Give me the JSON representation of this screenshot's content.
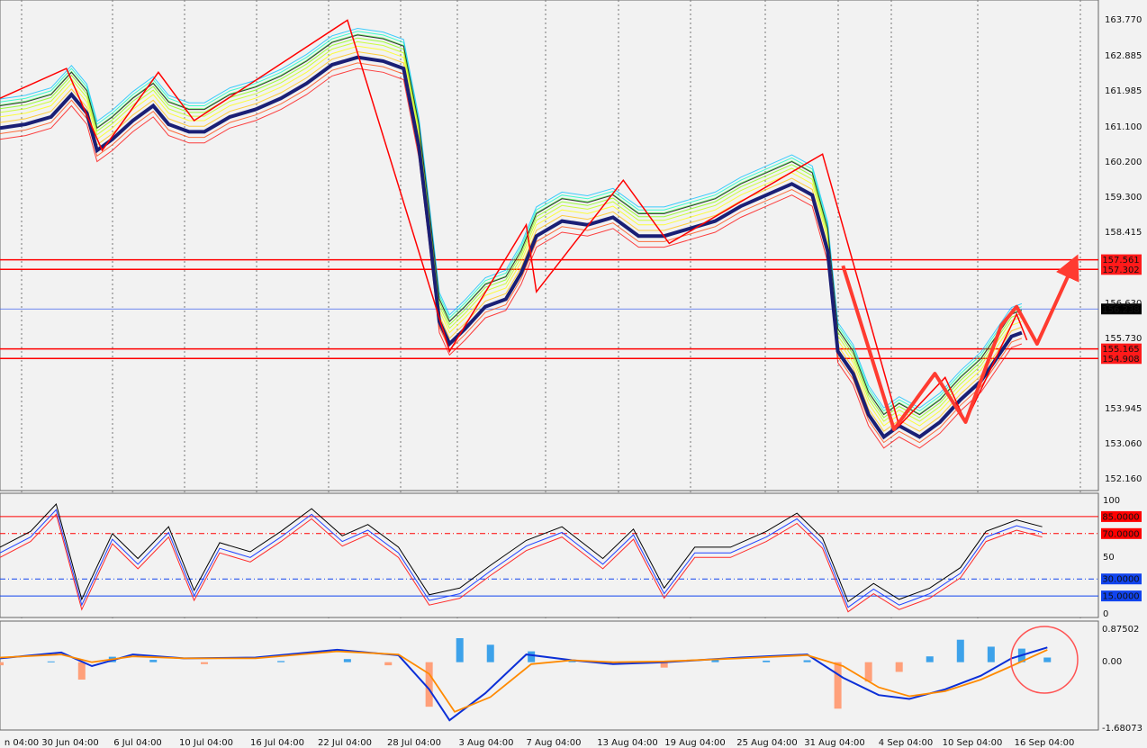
{
  "chart_data": [
    {
      "type": "candlestick",
      "panel": "main",
      "price_axis": {
        "ticks": [
          "163.770",
          "162.885",
          "161.985",
          "161.100",
          "160.200",
          "159.300",
          "158.415",
          "156.630",
          "155.730",
          "153.945",
          "153.060",
          "152.160"
        ],
        "ylim": [
          151.6,
          164.3
        ]
      },
      "level_lines": [
        {
          "label": "157.561",
          "value": 157.561,
          "color": "#ff0000"
        },
        {
          "label": "157.302",
          "value": 157.302,
          "color": "#ff0000"
        },
        {
          "label": "156.238",
          "value": 156.238,
          "color": "#4466ee"
        },
        {
          "label": "155.165",
          "value": 155.165,
          "color": "#ff0000"
        },
        {
          "label": "154.908",
          "value": 154.908,
          "color": "#ff0000"
        }
      ],
      "current_price_label": "156.238",
      "date_labels": [
        "n 04:00",
        "30 Jun 04:00",
        "6 Jul 04:00",
        "10 Jul 04:00",
        "16 Jul 04:00",
        "22 Jul 04:00",
        "28 Jul 04:00",
        "3 Aug 04:00",
        "7 Aug 04:00",
        "13 Aug 04:00",
        "19 Aug 04:00",
        "25 Aug 04:00",
        "31 Aug 04:00",
        "4 Sep 04:00",
        "10 Sep 04:00",
        "16 Sep 04:00"
      ],
      "close_path": [
        {
          "x": 0,
          "y": 161.7
        },
        {
          "x": 5,
          "y": 161.8
        },
        {
          "x": 10,
          "y": 162.0
        },
        {
          "x": 14,
          "y": 162.6
        },
        {
          "x": 17,
          "y": 162.1
        },
        {
          "x": 19,
          "y": 161.1
        },
        {
          "x": 22,
          "y": 161.4
        },
        {
          "x": 26,
          "y": 161.9
        },
        {
          "x": 30,
          "y": 162.3
        },
        {
          "x": 33,
          "y": 161.8
        },
        {
          "x": 37,
          "y": 161.6
        },
        {
          "x": 40,
          "y": 161.6
        },
        {
          "x": 45,
          "y": 162.0
        },
        {
          "x": 50,
          "y": 162.2
        },
        {
          "x": 55,
          "y": 162.5
        },
        {
          "x": 60,
          "y": 162.9
        },
        {
          "x": 65,
          "y": 163.4
        },
        {
          "x": 70,
          "y": 163.6
        },
        {
          "x": 75,
          "y": 163.5
        },
        {
          "x": 79,
          "y": 163.3
        },
        {
          "x": 82,
          "y": 161.2
        },
        {
          "x": 84,
          "y": 158.9
        },
        {
          "x": 86,
          "y": 156.5
        },
        {
          "x": 88,
          "y": 155.9
        },
        {
          "x": 91,
          "y": 156.3
        },
        {
          "x": 95,
          "y": 156.9
        },
        {
          "x": 99,
          "y": 157.1
        },
        {
          "x": 102,
          "y": 157.8
        },
        {
          "x": 105,
          "y": 158.8
        },
        {
          "x": 110,
          "y": 159.2
        },
        {
          "x": 115,
          "y": 159.1
        },
        {
          "x": 120,
          "y": 159.3
        },
        {
          "x": 125,
          "y": 158.8
        },
        {
          "x": 130,
          "y": 158.8
        },
        {
          "x": 135,
          "y": 159.0
        },
        {
          "x": 140,
          "y": 159.2
        },
        {
          "x": 145,
          "y": 159.6
        },
        {
          "x": 150,
          "y": 159.9
        },
        {
          "x": 155,
          "y": 160.2
        },
        {
          "x": 159,
          "y": 159.9
        },
        {
          "x": 162,
          "y": 158.4
        },
        {
          "x": 164,
          "y": 155.7
        },
        {
          "x": 167,
          "y": 155.1
        },
        {
          "x": 170,
          "y": 154.0
        },
        {
          "x": 173,
          "y": 153.4
        },
        {
          "x": 176,
          "y": 153.7
        },
        {
          "x": 180,
          "y": 153.4
        },
        {
          "x": 184,
          "y": 153.8
        },
        {
          "x": 188,
          "y": 154.4
        },
        {
          "x": 192,
          "y": 154.9
        },
        {
          "x": 195,
          "y": 155.5
        },
        {
          "x": 198,
          "y": 156.1
        },
        {
          "x": 200,
          "y": 156.2
        }
      ],
      "zigzag_points": [
        {
          "x": 0,
          "y": 161.9
        },
        {
          "x": 13,
          "y": 162.7
        },
        {
          "x": 20,
          "y": 160.5
        },
        {
          "x": 31,
          "y": 162.6
        },
        {
          "x": 38,
          "y": 161.3
        },
        {
          "x": 68,
          "y": 164.0
        },
        {
          "x": 88,
          "y": 155.1
        },
        {
          "x": 103,
          "y": 158.5
        },
        {
          "x": 105,
          "y": 156.7
        },
        {
          "x": 122,
          "y": 159.7
        },
        {
          "x": 131,
          "y": 158.0
        },
        {
          "x": 161,
          "y": 160.4
        },
        {
          "x": 176,
          "y": 153.1
        },
        {
          "x": 185,
          "y": 154.4
        },
        {
          "x": 189,
          "y": 153.2
        },
        {
          "x": 199,
          "y": 156.1
        },
        {
          "x": 201,
          "y": 155.4
        }
      ],
      "arrow_points": [
        {
          "x": 165,
          "y": 157.4
        },
        {
          "x": 175,
          "y": 153.0
        },
        {
          "x": 183,
          "y": 154.5
        },
        {
          "x": 189,
          "y": 153.2
        },
        {
          "x": 196,
          "y": 155.8
        },
        {
          "x": 199,
          "y": 156.3
        },
        {
          "x": 203,
          "y": 155.3
        },
        {
          "x": 210,
          "y": 157.4
        }
      ]
    },
    {
      "type": "line",
      "panel": "oscillator",
      "ylim": [
        0,
        100
      ],
      "levels": [
        {
          "label": "85.0000",
          "value": 85,
          "color": "#ff0000"
        },
        {
          "label": "70.0000",
          "value": 70,
          "color": "#ff0000"
        },
        {
          "label": "30.0000",
          "value": 30,
          "color": "#1144ee"
        },
        {
          "label": "15.0000",
          "value": 15,
          "color": "#1144ee"
        }
      ],
      "ticks": [
        "100",
        "50",
        "0"
      ],
      "series_values": [
        {
          "x": 0,
          "y": 58
        },
        {
          "x": 6,
          "y": 72
        },
        {
          "x": 11,
          "y": 96
        },
        {
          "x": 16,
          "y": 12
        },
        {
          "x": 22,
          "y": 70
        },
        {
          "x": 27,
          "y": 48
        },
        {
          "x": 33,
          "y": 76
        },
        {
          "x": 38,
          "y": 20
        },
        {
          "x": 43,
          "y": 62
        },
        {
          "x": 49,
          "y": 54
        },
        {
          "x": 55,
          "y": 72
        },
        {
          "x": 61,
          "y": 92
        },
        {
          "x": 67,
          "y": 68
        },
        {
          "x": 72,
          "y": 78
        },
        {
          "x": 78,
          "y": 58
        },
        {
          "x": 84,
          "y": 16
        },
        {
          "x": 90,
          "y": 22
        },
        {
          "x": 96,
          "y": 42
        },
        {
          "x": 103,
          "y": 64
        },
        {
          "x": 110,
          "y": 76
        },
        {
          "x": 118,
          "y": 48
        },
        {
          "x": 124,
          "y": 74
        },
        {
          "x": 130,
          "y": 22
        },
        {
          "x": 136,
          "y": 58
        },
        {
          "x": 143,
          "y": 58
        },
        {
          "x": 150,
          "y": 72
        },
        {
          "x": 156,
          "y": 88
        },
        {
          "x": 161,
          "y": 66
        },
        {
          "x": 166,
          "y": 10
        },
        {
          "x": 171,
          "y": 26
        },
        {
          "x": 176,
          "y": 12
        },
        {
          "x": 182,
          "y": 22
        },
        {
          "x": 188,
          "y": 40
        },
        {
          "x": 193,
          "y": 72
        },
        {
          "x": 199,
          "y": 82
        },
        {
          "x": 204,
          "y": 76
        }
      ]
    },
    {
      "type": "bar",
      "panel": "macd",
      "ylim": [
        -1.68073,
        0.87502
      ],
      "ticks": [
        "0.87502",
        "0.00",
        "-1.68073"
      ],
      "histogram": [
        {
          "x": 0,
          "y": -0.08
        },
        {
          "x": 10,
          "y": 0.02
        },
        {
          "x": 16,
          "y": -0.45
        },
        {
          "x": 22,
          "y": 0.14
        },
        {
          "x": 30,
          "y": 0.06
        },
        {
          "x": 40,
          "y": -0.05
        },
        {
          "x": 55,
          "y": 0.03
        },
        {
          "x": 68,
          "y": 0.08
        },
        {
          "x": 76,
          "y": -0.08
        },
        {
          "x": 84,
          "y": -1.15
        },
        {
          "x": 90,
          "y": 0.62
        },
        {
          "x": 96,
          "y": 0.45
        },
        {
          "x": 104,
          "y": 0.28
        },
        {
          "x": 112,
          "y": 0.05
        },
        {
          "x": 120,
          "y": -0.06
        },
        {
          "x": 130,
          "y": -0.14
        },
        {
          "x": 140,
          "y": 0.08
        },
        {
          "x": 150,
          "y": 0.04
        },
        {
          "x": 158,
          "y": 0.05
        },
        {
          "x": 164,
          "y": -1.2
        },
        {
          "x": 170,
          "y": -0.5
        },
        {
          "x": 176,
          "y": -0.25
        },
        {
          "x": 182,
          "y": 0.15
        },
        {
          "x": 188,
          "y": 0.58
        },
        {
          "x": 194,
          "y": 0.4
        },
        {
          "x": 200,
          "y": 0.35
        },
        {
          "x": 205,
          "y": 0.12
        }
      ],
      "macd_line": [
        {
          "x": 0,
          "y": 0.1
        },
        {
          "x": 12,
          "y": 0.25
        },
        {
          "x": 18,
          "y": -0.1
        },
        {
          "x": 26,
          "y": 0.2
        },
        {
          "x": 36,
          "y": 0.1
        },
        {
          "x": 50,
          "y": 0.12
        },
        {
          "x": 66,
          "y": 0.32
        },
        {
          "x": 78,
          "y": 0.18
        },
        {
          "x": 84,
          "y": -0.7
        },
        {
          "x": 88,
          "y": -1.5
        },
        {
          "x": 95,
          "y": -0.8
        },
        {
          "x": 103,
          "y": 0.2
        },
        {
          "x": 112,
          "y": 0.05
        },
        {
          "x": 120,
          "y": -0.05
        },
        {
          "x": 130,
          "y": 0.0
        },
        {
          "x": 145,
          "y": 0.12
        },
        {
          "x": 158,
          "y": 0.2
        },
        {
          "x": 165,
          "y": -0.4
        },
        {
          "x": 172,
          "y": -0.85
        },
        {
          "x": 178,
          "y": -0.95
        },
        {
          "x": 185,
          "y": -0.7
        },
        {
          "x": 192,
          "y": -0.35
        },
        {
          "x": 198,
          "y": 0.1
        },
        {
          "x": 205,
          "y": 0.38
        }
      ],
      "signal_line": [
        {
          "x": 0,
          "y": 0.12
        },
        {
          "x": 12,
          "y": 0.2
        },
        {
          "x": 18,
          "y": 0.0
        },
        {
          "x": 26,
          "y": 0.15
        },
        {
          "x": 36,
          "y": 0.1
        },
        {
          "x": 50,
          "y": 0.1
        },
        {
          "x": 66,
          "y": 0.28
        },
        {
          "x": 78,
          "y": 0.2
        },
        {
          "x": 84,
          "y": -0.3
        },
        {
          "x": 89,
          "y": -1.28
        },
        {
          "x": 96,
          "y": -0.9
        },
        {
          "x": 104,
          "y": -0.05
        },
        {
          "x": 112,
          "y": 0.05
        },
        {
          "x": 120,
          "y": 0.0
        },
        {
          "x": 130,
          "y": 0.02
        },
        {
          "x": 145,
          "y": 0.1
        },
        {
          "x": 158,
          "y": 0.18
        },
        {
          "x": 165,
          "y": -0.1
        },
        {
          "x": 172,
          "y": -0.65
        },
        {
          "x": 178,
          "y": -0.88
        },
        {
          "x": 185,
          "y": -0.75
        },
        {
          "x": 192,
          "y": -0.45
        },
        {
          "x": 198,
          "y": -0.1
        },
        {
          "x": 205,
          "y": 0.32
        }
      ]
    }
  ]
}
